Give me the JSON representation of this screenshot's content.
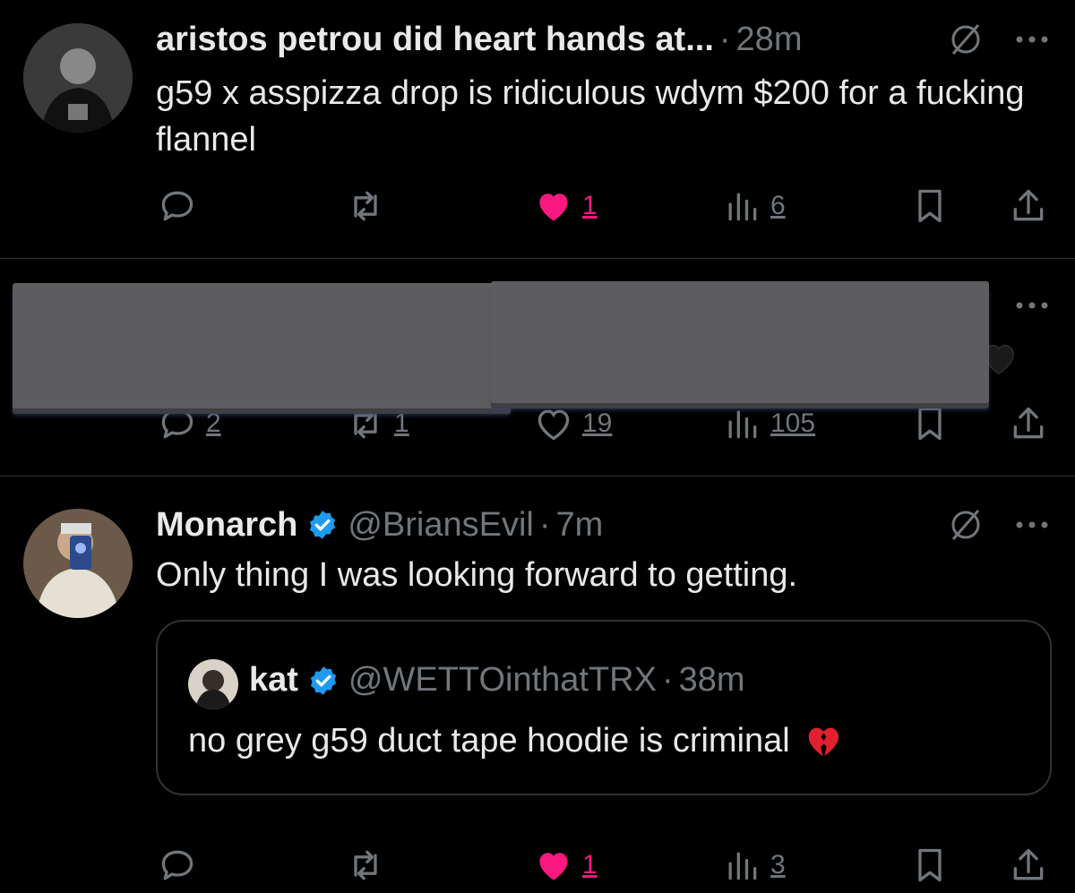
{
  "tweets": [
    {
      "name": "aristos petrou did heart hands at...",
      "time": "28m",
      "text": "g59 x asspizza drop is ridiculous wdym $200 for a fucking flannel",
      "stats": {
        "replies": "",
        "reposts": "",
        "likes": "1",
        "views": "6"
      }
    },
    {
      "stats": {
        "replies": "2",
        "reposts": "1",
        "likes": "19",
        "views": "105"
      }
    },
    {
      "name": "Monarch",
      "handle": "@BriansEvil",
      "time": "7m",
      "text": "Only thing I was looking forward to getting.",
      "quote": {
        "name": "kat",
        "handle": "@WETTOinthatTRX",
        "time": "38m",
        "text": "no grey g59 duct tape hoodie is criminal"
      },
      "stats": {
        "replies": "",
        "reposts": "",
        "likes": "1",
        "views": "3"
      }
    }
  ],
  "separator": "·",
  "colors": {
    "like": "#f91880",
    "verified": "#1d9bf0",
    "muted": "#71767b",
    "divider": "#2f3336"
  },
  "icons": [
    "reply-icon",
    "repost-icon",
    "like-icon",
    "views-icon",
    "bookmark-icon",
    "share-icon",
    "grok-icon",
    "more-icon",
    "verified-badge-icon",
    "broken-heart-emoji",
    "black-heart-emoji"
  ]
}
